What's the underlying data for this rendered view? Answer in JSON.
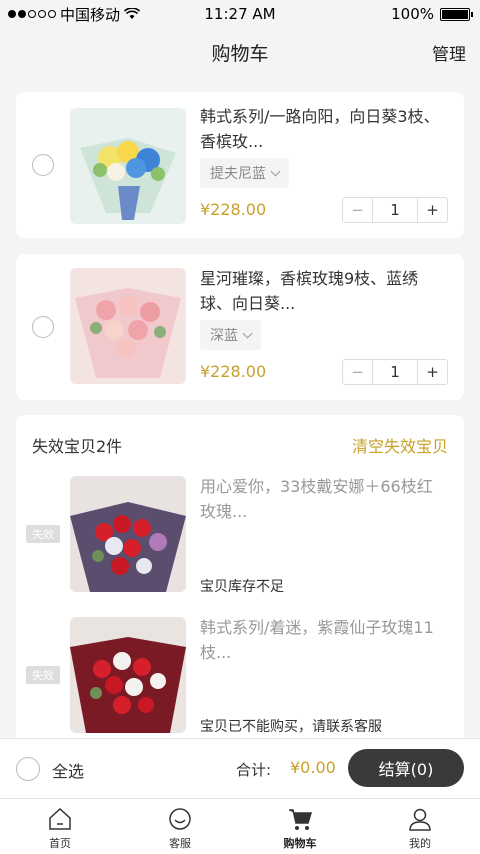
{
  "status_bar": {
    "carrier": "中国移动",
    "time": "11:27 AM",
    "battery": "100%"
  },
  "nav": {
    "title": "购物车",
    "manage": "管理"
  },
  "cart_items": [
    {
      "title": "韩式系列/一路向阳，向日葵3枝、香槟玫...",
      "spec": "提夫尼蓝",
      "price": "¥228.00",
      "qty": "1"
    },
    {
      "title": "星河璀璨，香槟玫瑰9枝、蓝绣球、向日葵...",
      "spec": "深蓝",
      "price": "¥228.00",
      "qty": "1"
    }
  ],
  "invalid": {
    "header": "失效宝贝2件",
    "clear": "清空失效宝贝",
    "badge": "失效",
    "items": [
      {
        "title": "用心爱你，33枝戴安娜＋66枝红玫瑰...",
        "reason": "宝贝库存不足"
      },
      {
        "title": "韩式系列/着迷，紫霞仙子玫瑰11枝...",
        "reason": "宝贝已不能购买，请联系客服"
      }
    ]
  },
  "bottom": {
    "select_all": "全选",
    "total_label": "合计:",
    "total": "¥0.00",
    "checkout": "结算(0)"
  },
  "tabs": [
    {
      "label": "首页",
      "icon": "home-icon"
    },
    {
      "label": "客服",
      "icon": "service-icon"
    },
    {
      "label": "购物车",
      "icon": "cart-icon"
    },
    {
      "label": "我的",
      "icon": "user-icon"
    }
  ],
  "colors": {
    "accent": "#c9a02a",
    "checkout_bg": "#3a3a3a"
  }
}
